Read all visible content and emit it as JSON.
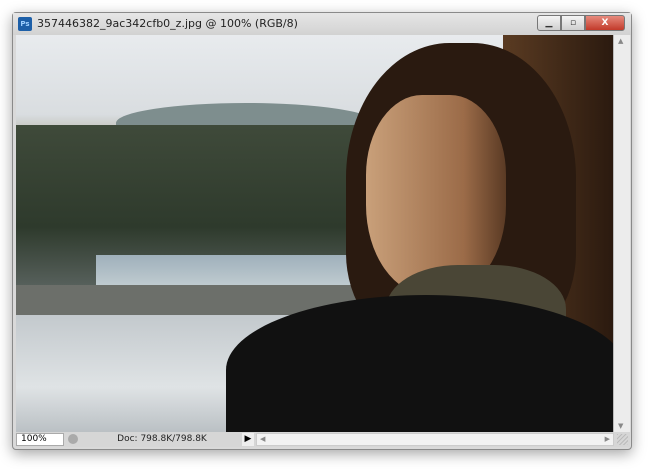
{
  "window": {
    "title": "357446382_9ac342cfb0_z.jpg @ 100% (RGB/8)",
    "app_icon": "Ps",
    "buttons": {
      "minimize": "▁",
      "maximize": "▫",
      "close": "X"
    }
  },
  "status": {
    "zoom": "100%",
    "doc": "Doc: 798.8K/798.8K",
    "menu_arrow": "▶"
  },
  "scroll": {
    "left": "◀",
    "right": "▶",
    "up": "▲",
    "down": "▼"
  }
}
